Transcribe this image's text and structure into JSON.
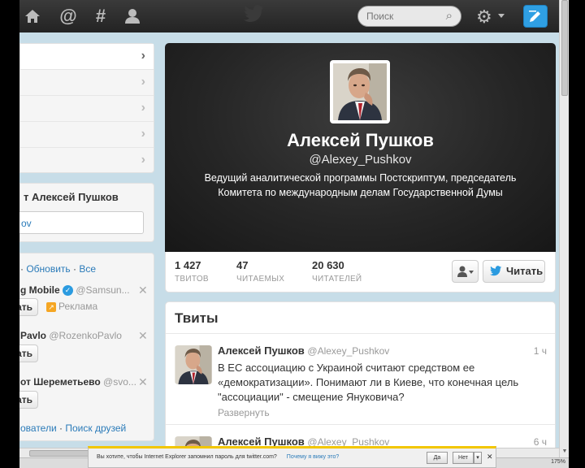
{
  "topbar": {
    "icons": [
      "home-icon",
      "connect-icon",
      "discover-icon",
      "me-icon"
    ],
    "search_placeholder": "Поиск",
    "colors": {
      "bar": "#2a2a2a",
      "compose": "#2f9fe3"
    }
  },
  "sidebar": {
    "tweet_box_title": "т Алексей Пушков",
    "tweet_box_value": "ov",
    "wtf": {
      "refresh": "Обновить",
      "separator": "·",
      "all": "Все",
      "suggestions": [
        {
          "name": "g Mobile",
          "handle": "@Samsun...",
          "button": "тать",
          "promo": "Реклама",
          "verified": true
        },
        {
          "name": "Pavlo",
          "handle": "@RozenkoPavlo",
          "button": "тать"
        },
        {
          "name": "от Шереметьево",
          "handle": "@svo...",
          "button": "тать"
        }
      ],
      "footer_left": "ователи",
      "footer_sep": "·",
      "footer_right": "Поиск друзей"
    }
  },
  "profile": {
    "name": "Алексей Пушков",
    "handle": "@Alexey_Pushkov",
    "bio_line1": "Ведущий аналитической программы Постскриптум, председатель",
    "bio_line2": "Комитета по международным делам Государственной Думы",
    "stats": [
      {
        "value": "1 427",
        "label": "ТВИТОВ"
      },
      {
        "value": "47",
        "label": "ЧИТАЕМЫХ"
      },
      {
        "value": "20 630",
        "label": "ЧИТАТЕЛЕЙ"
      }
    ],
    "follow_label": "Читать"
  },
  "tweets": {
    "title": "Твиты",
    "items": [
      {
        "name": "Алексей Пушков",
        "handle": "@Alexey_Pushkov",
        "time": "1 ч",
        "line1": "В ЕС ассоциацию с Украиной считают средством ее",
        "line2": "«демократизации». Понимают ли в Киеве, что конечная цель",
        "line3": "\"ассоциации\" - смещение Януковича?",
        "expand": "Развернуть"
      },
      {
        "name": "Алексей Пушков",
        "handle": "@Alexey_Pushkov",
        "time": "6 ч"
      }
    ]
  },
  "ie_bar": {
    "message": "Вы хотите, чтобы Internet Explorer запомнил пароль для twitter.com?",
    "why_link": "Почему я вижу это?",
    "yes": "Да",
    "no": "Нет",
    "accent": "#f2c600"
  },
  "status": {
    "zoom": "175%"
  }
}
